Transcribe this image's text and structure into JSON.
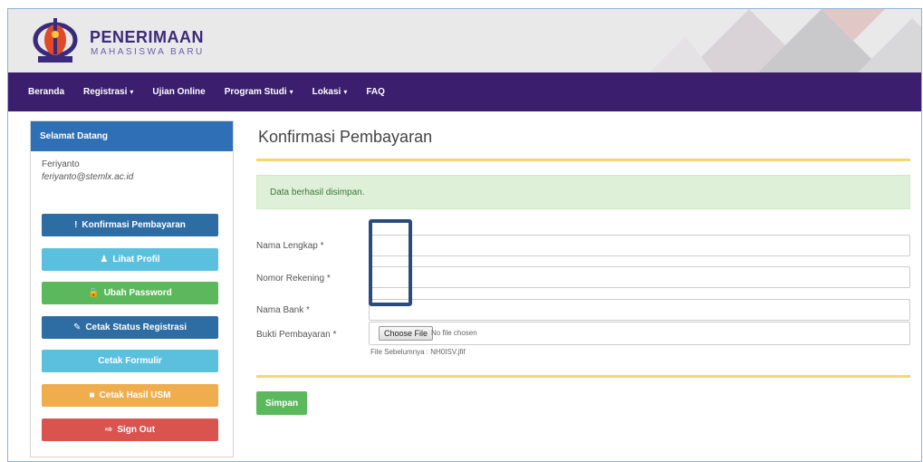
{
  "brand": {
    "title": "PENERIMAAN",
    "subtitle": "MAHASISWA BARU"
  },
  "nav": [
    {
      "label": "Beranda",
      "dropdown": false
    },
    {
      "label": "Registrasi",
      "dropdown": true
    },
    {
      "label": "Ujian Online",
      "dropdown": false
    },
    {
      "label": "Program Studi",
      "dropdown": true
    },
    {
      "label": "Lokasi",
      "dropdown": true
    },
    {
      "label": "FAQ",
      "dropdown": false
    }
  ],
  "sidebar": {
    "heading": "Selamat Datang",
    "user_name": "Feriyanto",
    "user_email": "feriyanto@stemlx.ac.id",
    "buttons": [
      {
        "label": "Konfirmasi Pembayaran",
        "icon": "info-icon",
        "glyph": "!",
        "color": "#2e6da4"
      },
      {
        "label": "Lihat Profil",
        "icon": "user-icon",
        "glyph": "♟",
        "color": "#5bc0de"
      },
      {
        "label": "Ubah Password",
        "icon": "lock-icon",
        "glyph": "🔒",
        "color": "#5cb85c"
      },
      {
        "label": "Cetak Status Registrasi",
        "icon": "edit-icon",
        "glyph": "✎",
        "color": "#2e6da4"
      },
      {
        "label": "Cetak Formulir",
        "icon": "",
        "glyph": "",
        "color": "#5bc0de"
      },
      {
        "label": "Cetak Hasil USM",
        "icon": "file-icon",
        "glyph": "■",
        "color": "#f0ad4e"
      },
      {
        "label": "Sign Out",
        "icon": "sign-out-icon",
        "glyph": "⇨",
        "color": "#d9534f"
      }
    ]
  },
  "main": {
    "title": "Konfirmasi Pembayaran",
    "alert": "Data berhasil disimpan.",
    "fields": [
      {
        "label": "Nama Lengkap *",
        "value": ""
      },
      {
        "label": "Nomor Rekening *",
        "value": ""
      },
      {
        "label": "Nama Bank *",
        "value": ""
      }
    ],
    "file_field": {
      "label": "Bukti Pembayaran *",
      "button": "Choose File",
      "status": "No file chosen",
      "previous": "File Sebelumnya : NH0ISV.jfif"
    },
    "save_label": "Simpan"
  }
}
